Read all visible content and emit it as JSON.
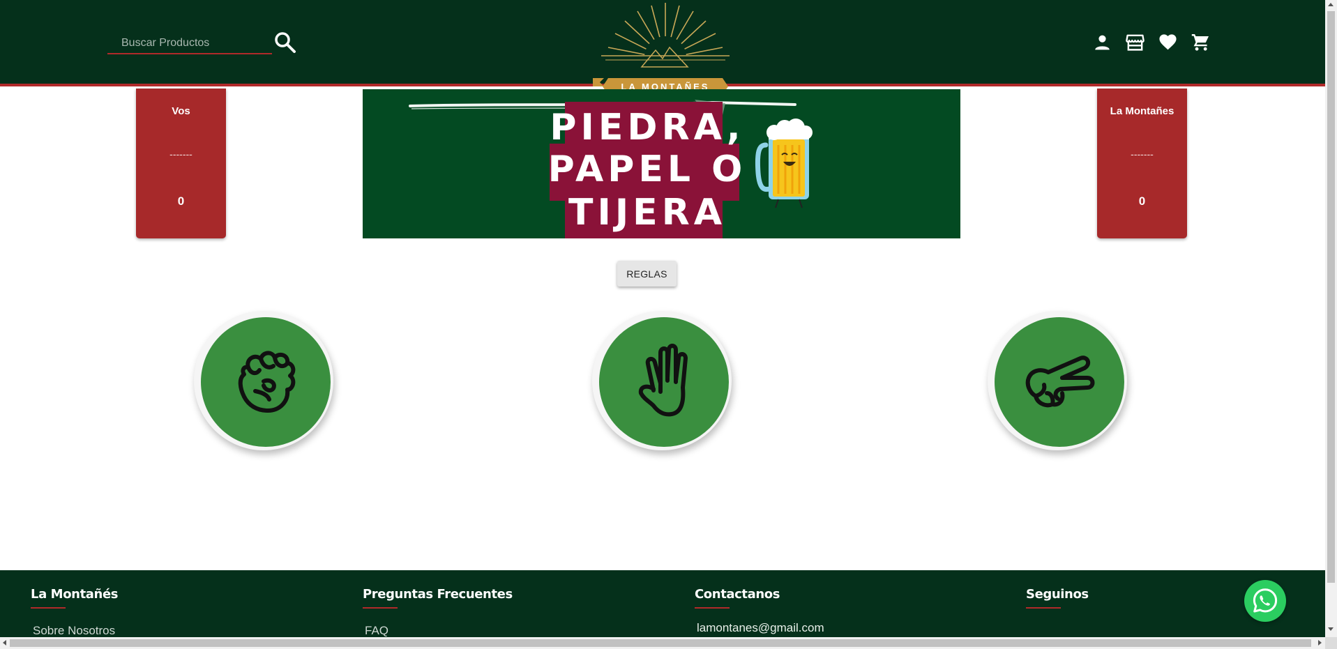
{
  "header": {
    "search_placeholder": "Buscar Productos",
    "logo_text": "LA MONTAÑES",
    "icons": [
      "user-icon",
      "store-icon",
      "heart-icon",
      "cart-icon"
    ]
  },
  "scoreboard": {
    "player": {
      "name": "Vos",
      "choice": "-------",
      "points": "0"
    },
    "cpu": {
      "name": "La Montañes",
      "choice": "-------",
      "points": "0"
    }
  },
  "banner": {
    "line1": "PIEDRA,",
    "line2": "PAPEL O",
    "line3": "TIJERA"
  },
  "rules_button": "REGLAS",
  "choices": [
    {
      "name": "piedra",
      "icon": "rock-hand-icon"
    },
    {
      "name": "papel",
      "icon": "paper-hand-icon"
    },
    {
      "name": "tijera",
      "icon": "scissors-hand-icon"
    }
  ],
  "footer": {
    "col1": {
      "title": "La Montañés",
      "link": "Sobre Nosotros"
    },
    "col2": {
      "title": "Preguntas Frecuentes",
      "link": "FAQ"
    },
    "col3": {
      "title": "Contactanos",
      "email": "lamontanes@gmail.com"
    },
    "col4": {
      "title": "Seguinos"
    }
  },
  "colors": {
    "header_bg": "#05301b",
    "accent_red": "#a7292a",
    "choice_green": "#3a8f3f",
    "banner_green": "#034a22",
    "banner_title_bg": "#8a1238",
    "logo_gold": "#c9963a",
    "whatsapp_green": "#2bcd60"
  }
}
